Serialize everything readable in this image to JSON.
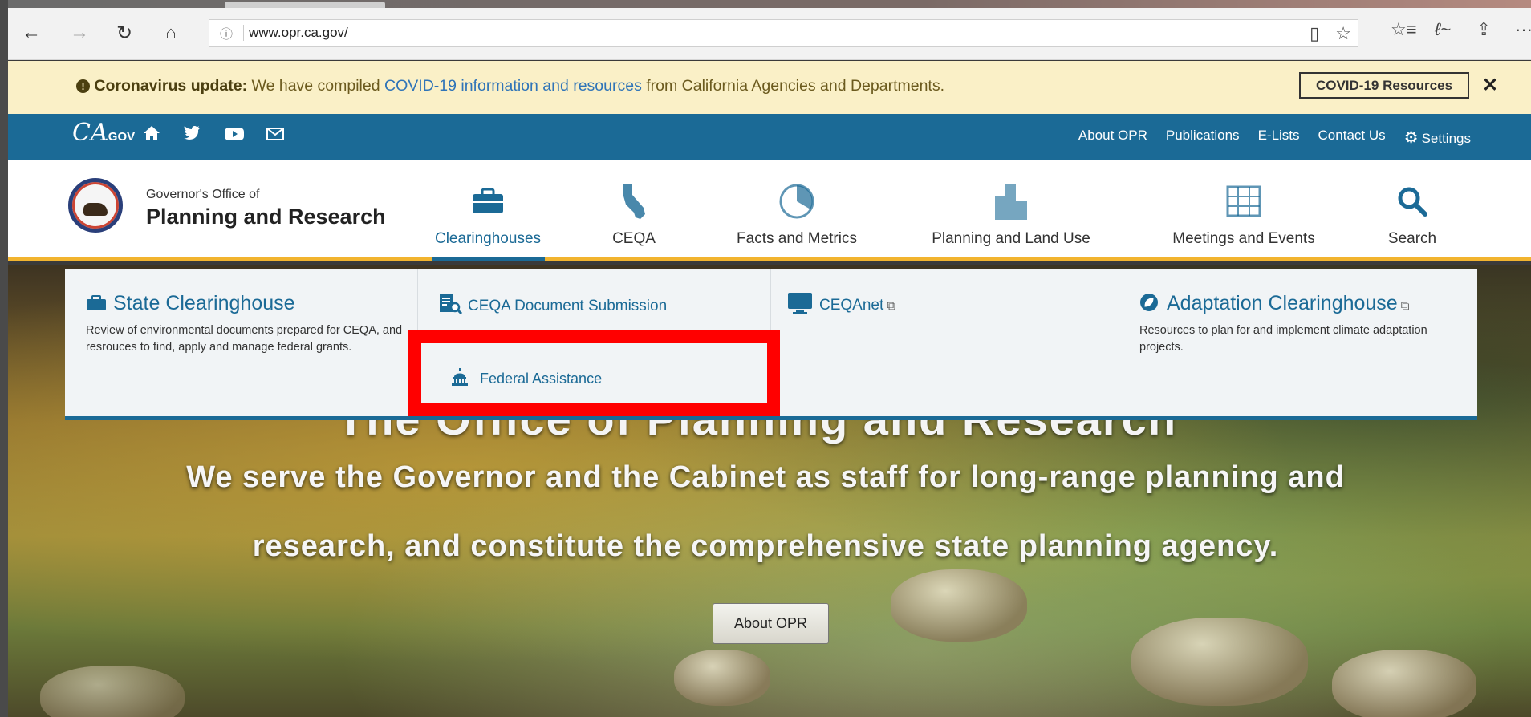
{
  "browser": {
    "url": "www.opr.ca.gov/",
    "icons": [
      "back-arrow-icon",
      "forward-arrow-icon",
      "refresh-icon",
      "home-icon",
      "info-icon",
      "reading-view-icon",
      "favorite-star-icon",
      "favorites-list-icon",
      "pen-icon",
      "share-icon",
      "more-icon"
    ]
  },
  "covid_banner": {
    "bold": "Coronavirus update:",
    "text_before": " We have compiled ",
    "link": "COVID-19 information and resources",
    "text_after": " from California Agencies and Departments.",
    "button": "COVID-19 Resources",
    "close": "✕"
  },
  "utility_bar": {
    "logo_ca": "CA",
    "logo_gov": ".GOV",
    "links": [
      "About OPR",
      "Publications",
      "E-Lists",
      "Contact Us",
      "Settings"
    ]
  },
  "header": {
    "org_small": "Governor's Office of",
    "org_big": "Planning and Research"
  },
  "nav": {
    "items": [
      {
        "label": "Clearinghouses"
      },
      {
        "label": "CEQA"
      },
      {
        "label": "Facts and Metrics"
      },
      {
        "label": "Planning and Land Use"
      },
      {
        "label": "Meetings and Events"
      },
      {
        "label": "Search"
      }
    ]
  },
  "dropdown": {
    "state": {
      "title": "State Clearinghouse",
      "desc": "Review of environmental documents prepared for CEQA, and resrouces to find, apply and manage federal grants."
    },
    "ceqa_submission": "CEQA Document Submission",
    "federal": "Federal Assistance",
    "ceqanet": "CEQAnet",
    "adaptation": {
      "title": "Adaptation Clearinghouse",
      "desc": "Resources to plan for and implement climate adaptation projects."
    }
  },
  "hero": {
    "title_partial": "The Office of Planning and Research",
    "line1": "We serve the Governor and the Cabinet as staff for long-range planning and",
    "line2": "research, and constitute the comprehensive state planning agency.",
    "button": "About OPR"
  },
  "colors": {
    "brand_blue": "#1b6a96",
    "accent_gold": "#f2b42f",
    "banner_bg": "#faf0c7",
    "highlight_red": "#ff0000"
  }
}
